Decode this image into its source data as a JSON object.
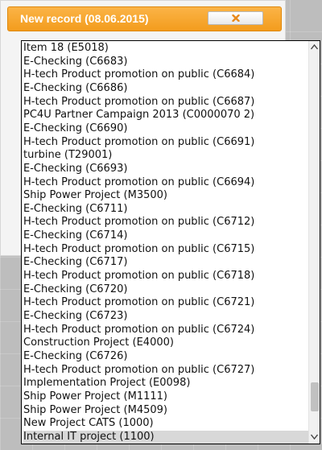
{
  "dialog": {
    "title": "New record (08.06.2015)",
    "close_icon": "close-icon",
    "accent_color": "#f4a62a"
  },
  "list": {
    "items": [
      {
        "label": "Item 18 (E5018)"
      },
      {
        "label": "E-Checking (C6683)"
      },
      {
        "label": "H-tech Product promotion on public (C6684)"
      },
      {
        "label": "E-Checking (C6686)"
      },
      {
        "label": "H-tech Product promotion on public (C6687)"
      },
      {
        "label": "PC4U Partner Campaign 2013 (C0000070 2)"
      },
      {
        "label": "E-Checking (C6690)"
      },
      {
        "label": "H-tech Product promotion on public (C6691)"
      },
      {
        "label": "turbine (T29001)"
      },
      {
        "label": "E-Checking (C6693)"
      },
      {
        "label": "H-tech Product promotion on public (C6694)"
      },
      {
        "label": "Ship Power Project (M3500)"
      },
      {
        "label": "E-Checking (C6711)"
      },
      {
        "label": "H-tech Product promotion on public (C6712)"
      },
      {
        "label": "E-Checking (C6714)"
      },
      {
        "label": "H-tech Product promotion on public (C6715)"
      },
      {
        "label": "E-Checking (C6717)"
      },
      {
        "label": "H-tech Product promotion on public (C6718)"
      },
      {
        "label": "E-Checking (C6720)"
      },
      {
        "label": "H-tech Product promotion on public (C6721)"
      },
      {
        "label": "E-Checking (C6723)"
      },
      {
        "label": "H-tech Product promotion on public (C6724)"
      },
      {
        "label": "Construction Project (E4000)"
      },
      {
        "label": "E-Checking (C6726)"
      },
      {
        "label": "H-tech Product promotion on public (C6727)"
      },
      {
        "label": "Implementation Project (E0098)"
      },
      {
        "label": "Ship Power Project (M1111)"
      },
      {
        "label": "Ship Power Project (M4509)"
      },
      {
        "label": "New Project CATS (1000)"
      },
      {
        "label": "Internal IT project (1100)",
        "selected": true
      }
    ],
    "selected_label": "Internal IT project (1100)",
    "scroll_up_icon": "arrow-up-icon",
    "scroll_down_icon": "arrow-down-icon"
  }
}
